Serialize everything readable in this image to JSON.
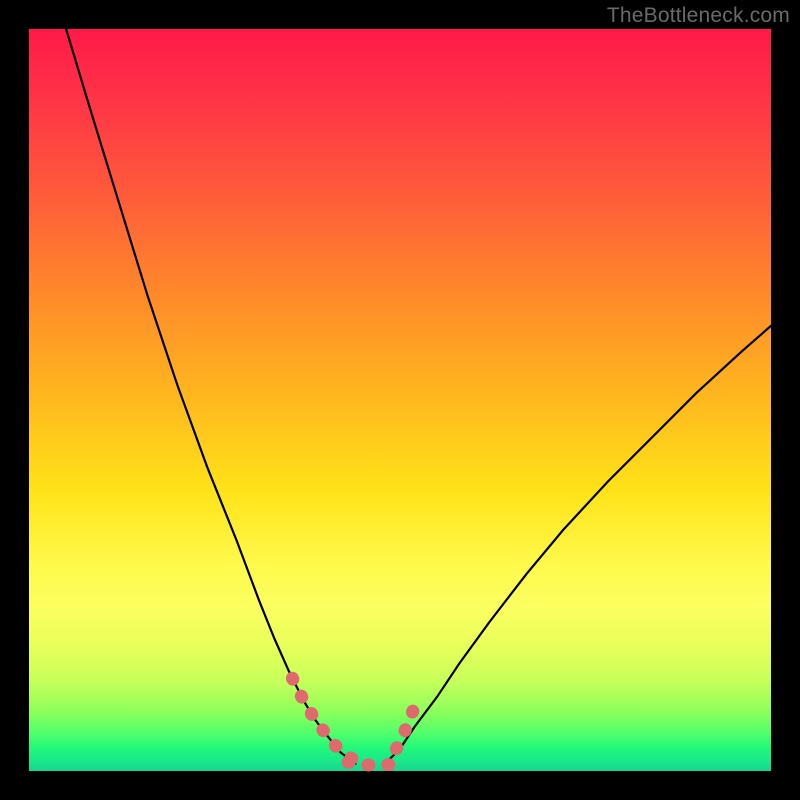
{
  "watermark": "TheBottleneck.com",
  "colors": {
    "background_frame": "#000000",
    "curve_stroke": "#000000",
    "highlight_stroke": "#df6a6e",
    "gradient_top": "#ff1a48",
    "gradient_mid": "#fff94a",
    "gradient_bottom": "#17d68e"
  },
  "chart_data": {
    "type": "line",
    "title": "",
    "xlabel": "",
    "ylabel": "",
    "xlim": [
      0,
      100
    ],
    "ylim": [
      0,
      100
    ],
    "grid": false,
    "legend": false,
    "series": [
      {
        "name": "left-branch",
        "x": [
          5,
          8,
          12,
          16,
          20,
          24,
          28,
          31,
          33,
          35,
          37,
          38.5,
          40,
          42,
          44
        ],
        "values": [
          100,
          90,
          77,
          64,
          52,
          41,
          31,
          23,
          18,
          13.5,
          9.5,
          7,
          5,
          2.5,
          1
        ]
      },
      {
        "name": "right-branch",
        "x": [
          48,
          50,
          52,
          55,
          58,
          62,
          67,
          72,
          78,
          84,
          90,
          96,
          100
        ],
        "values": [
          1,
          3,
          6,
          10,
          14.5,
          20,
          26.5,
          32.5,
          39,
          45,
          51,
          56.5,
          60
        ]
      },
      {
        "name": "highlight-left",
        "x": [
          35.5,
          37,
          38.5,
          40,
          41.5,
          43,
          44.3
        ],
        "values": [
          12.5,
          9.5,
          7,
          5,
          3.2,
          2,
          1.2
        ]
      },
      {
        "name": "highlight-bottom",
        "x": [
          43,
          44.5,
          46,
          47.5,
          49,
          50.5
        ],
        "values": [
          1.2,
          0.9,
          0.8,
          0.8,
          0.9,
          1.2
        ]
      },
      {
        "name": "highlight-right",
        "x": [
          49.5,
          50.5,
          51.5,
          52.5
        ],
        "values": [
          3,
          5,
          7.5,
          10
        ]
      }
    ],
    "annotations": []
  }
}
